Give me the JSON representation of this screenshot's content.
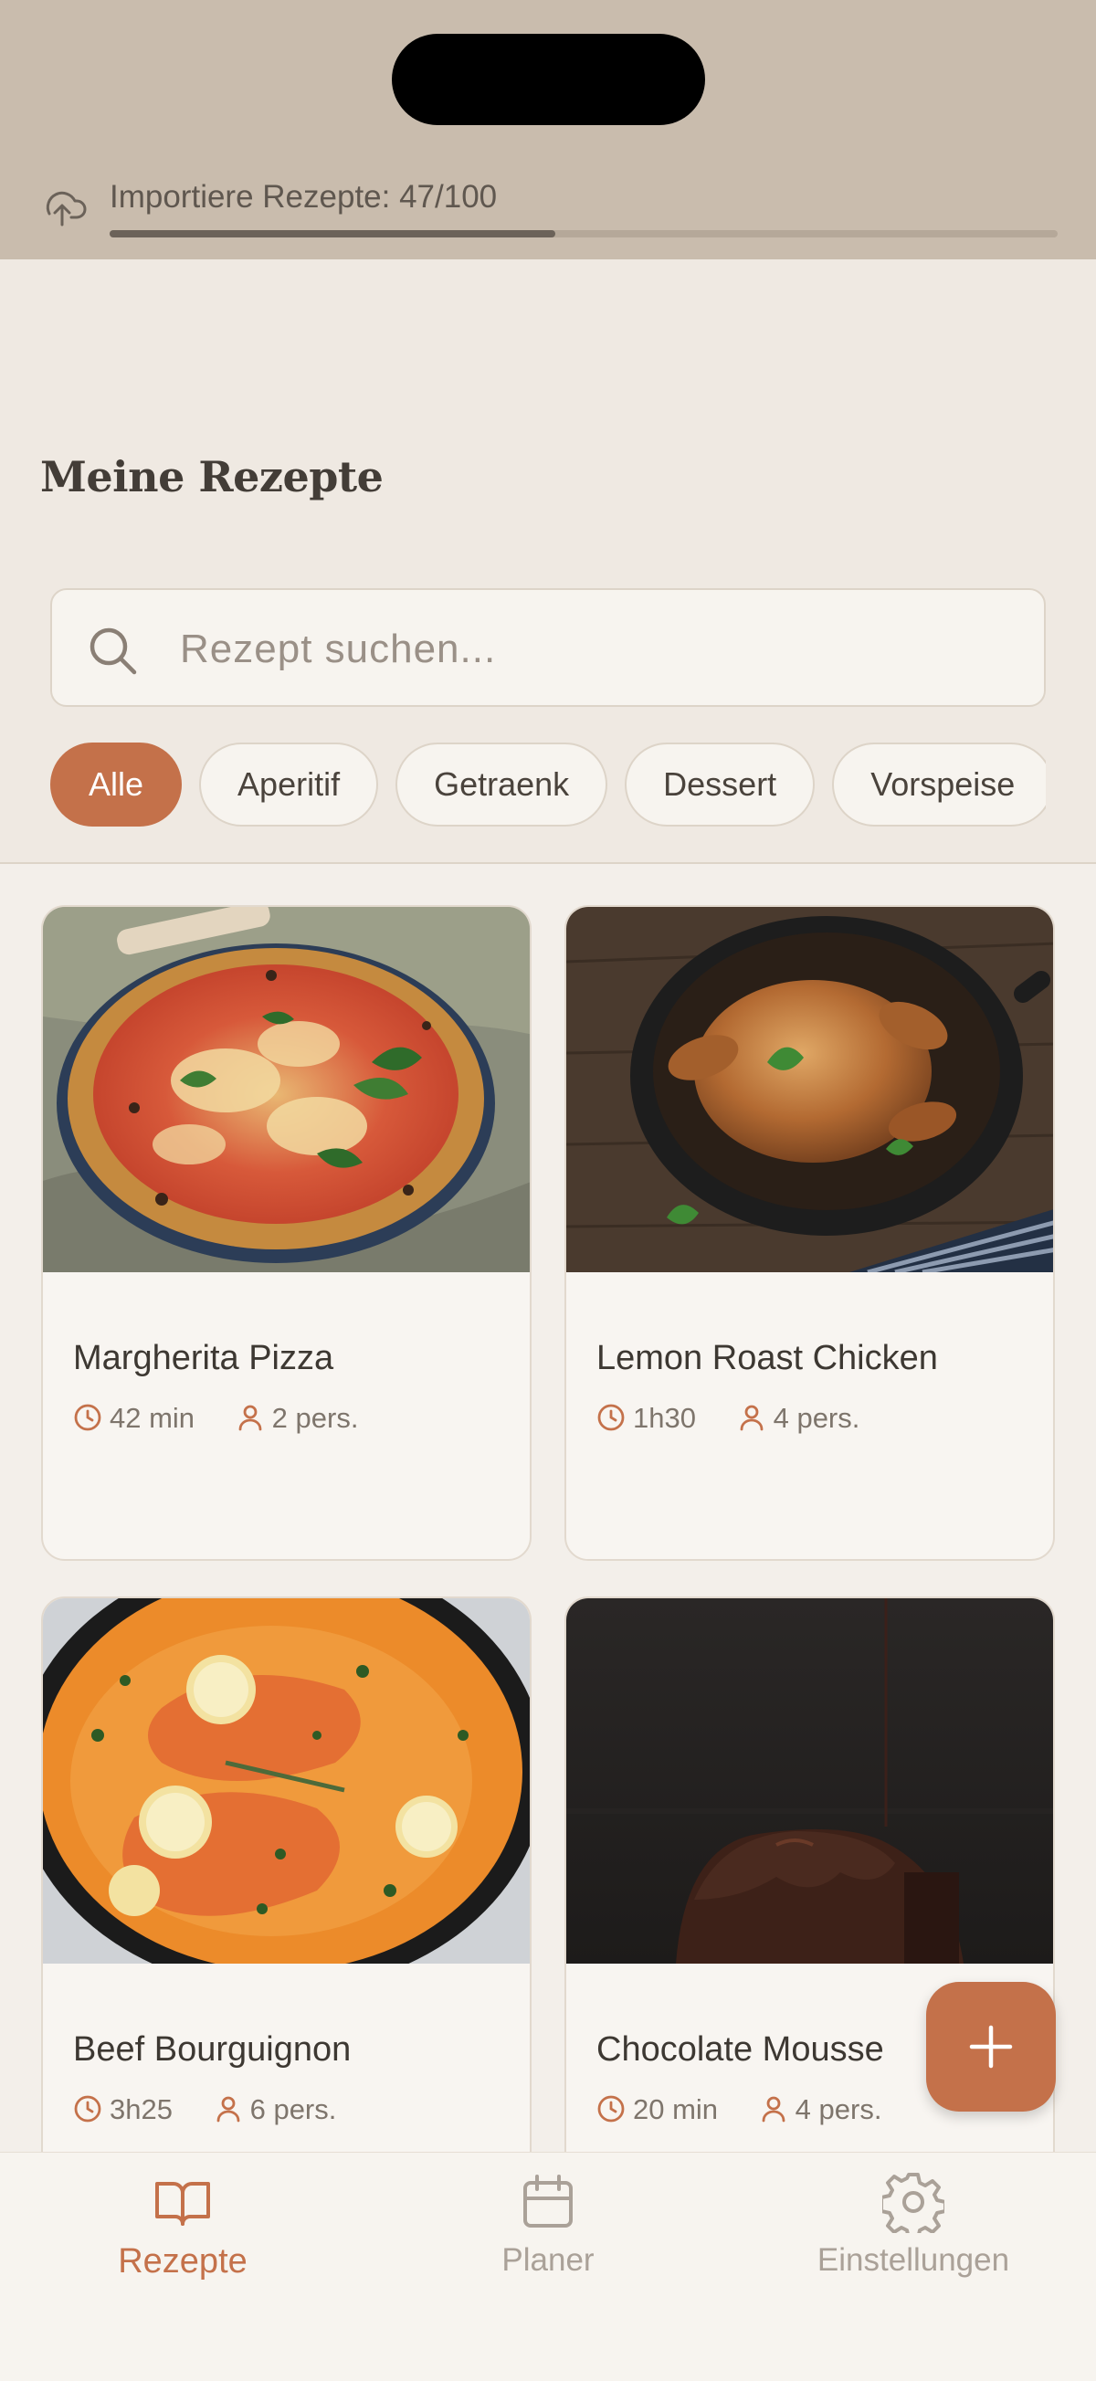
{
  "import_banner": {
    "text": "Importiere Rezepte: 47/100",
    "progress": 0.47,
    "icon": "cloud-upload-icon"
  },
  "header": {
    "title": "Meine Rezepte"
  },
  "search": {
    "placeholder": "Rezept suchen...",
    "value": "",
    "icon": "search-icon"
  },
  "filters": {
    "chips": [
      {
        "label": "Alle",
        "active": true
      },
      {
        "label": "Aperitif",
        "active": false
      },
      {
        "label": "Getraenk",
        "active": false
      },
      {
        "label": "Dessert",
        "active": false
      },
      {
        "label": "Vorspeise",
        "active": false
      }
    ]
  },
  "recipes": [
    {
      "title": "Margherita Pizza",
      "time": "42 min",
      "servings": "2 pers.",
      "image": "pizza"
    },
    {
      "title": "Lemon Roast Chicken",
      "time": "1h30",
      "servings": "4 pers.",
      "image": "roast-chicken"
    },
    {
      "title": "Beef Bourguignon",
      "time": "3h25",
      "servings": "6 pers.",
      "image": "salmon-pan"
    },
    {
      "title": "Chocolate Mousse",
      "time": "20 min",
      "servings": "4 pers.",
      "image": "chocolate-cake"
    }
  ],
  "fab": {
    "icon": "plus-icon"
  },
  "bottom_nav": {
    "items": [
      {
        "label": "Rezepte",
        "icon": "book-icon",
        "active": true
      },
      {
        "label": "Planer",
        "icon": "calendar-icon",
        "active": false
      },
      {
        "label": "Einstellungen",
        "icon": "gear-icon",
        "active": false
      }
    ]
  },
  "colors": {
    "accent": "#c4714a",
    "background": "#efe9e2",
    "banner": "#c9bcad",
    "text": "#3d3832",
    "muted": "#7e756c"
  }
}
